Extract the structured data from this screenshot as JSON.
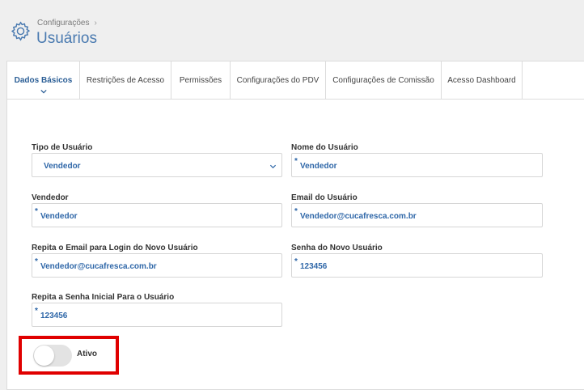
{
  "header": {
    "breadcrumb": "Configurações",
    "title": "Usuários",
    "icon": "gear-icon"
  },
  "tabs": [
    {
      "label": "Dados Básicos",
      "active": true
    },
    {
      "label": "Restrições de Acesso",
      "active": false
    },
    {
      "label": "Permissões",
      "active": false
    },
    {
      "label": "Configurações do PDV",
      "active": false
    },
    {
      "label": "Configurações de Comissão",
      "active": false
    },
    {
      "label": "Acesso Dashboard",
      "active": false
    }
  ],
  "form": {
    "tipo_usuario": {
      "label": "Tipo de Usuário",
      "value": "Vendedor"
    },
    "nome_usuario": {
      "label": "Nome do Usuário",
      "value": "Vendedor",
      "required_mark": "*"
    },
    "vendedor": {
      "label": "Vendedor",
      "value": "Vendedor",
      "required_mark": "*"
    },
    "email_usuario": {
      "label": "Email do Usuário",
      "value": "Vendedor@cucafresca.com.br",
      "required_mark": "*"
    },
    "repita_email": {
      "label": "Repita o Email para Login do Novo Usuário",
      "value": "Vendedor@cucafresca.com.br",
      "required_mark": "*"
    },
    "senha": {
      "label": "Senha do Novo Usuário",
      "value": "123456",
      "required_mark": "*"
    },
    "repita_senha": {
      "label": "Repita a Senha Inicial Para o Usuário",
      "value": "123456",
      "required_mark": "*"
    },
    "ativo": {
      "label": "Ativo",
      "checked": false
    }
  },
  "colors": {
    "accent": "#2f67a8",
    "highlight": "#e00000"
  }
}
